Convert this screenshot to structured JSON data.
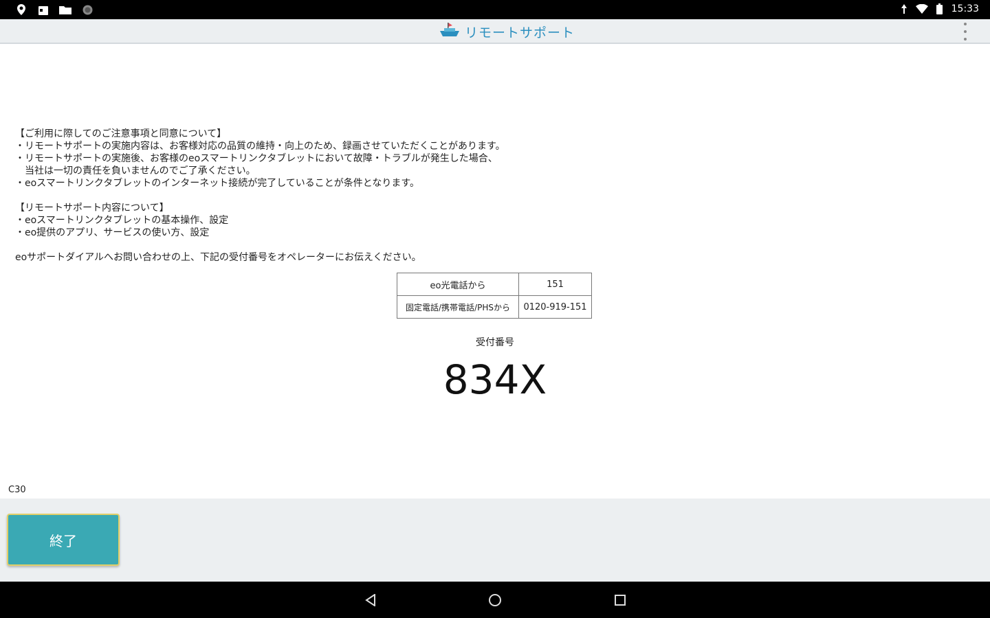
{
  "status_bar": {
    "time": "15:33",
    "left_icons": [
      "location-icon",
      "calendar-icon",
      "folder-icon",
      "circle-icon"
    ],
    "right_icons": [
      "signal-icon",
      "wifi-icon",
      "battery-icon"
    ]
  },
  "app_bar": {
    "title": "リモートサポート",
    "logo_icon": "remote-support-logo-icon",
    "menu_icon": "kebab-menu-icon"
  },
  "notice": {
    "section1_title": "【ご利用に際してのご注意事項と同意について】",
    "section1_lines": [
      "・リモートサポートの実施内容は、お客様対応の品質の維持・向上のため、録画させていただくことがあります。",
      "・リモートサポートの実施後、お客様のeoスマートリンクタブレットにおいて故障・トラブルが発生した場合、",
      "　当社は一切の責任を負いませんのでご了承ください。",
      "・eoスマートリンクタブレットのインターネット接続が完了していることが条件となります。"
    ],
    "section2_title": "【リモートサポート内容について】",
    "section2_lines": [
      "・eoスマートリンクタブレットの基本操作、設定",
      "・eo提供のアプリ、サービスの使い方、設定"
    ],
    "instruction": "eoサポートダイアルへお問い合わせの上、下記の受付番号をオペレーターにお伝えください。"
  },
  "phone_table": {
    "rows": [
      [
        "eo光電話から",
        "151"
      ],
      [
        "固定電話/携帯電話/PHSから",
        "0120-919-151"
      ]
    ]
  },
  "reception": {
    "label": "受付番号",
    "number": "834X"
  },
  "code": "C30",
  "footer": {
    "end_label": "終了"
  },
  "nav_bar": {
    "icons": [
      "back-icon",
      "home-icon",
      "recents-icon"
    ]
  }
}
